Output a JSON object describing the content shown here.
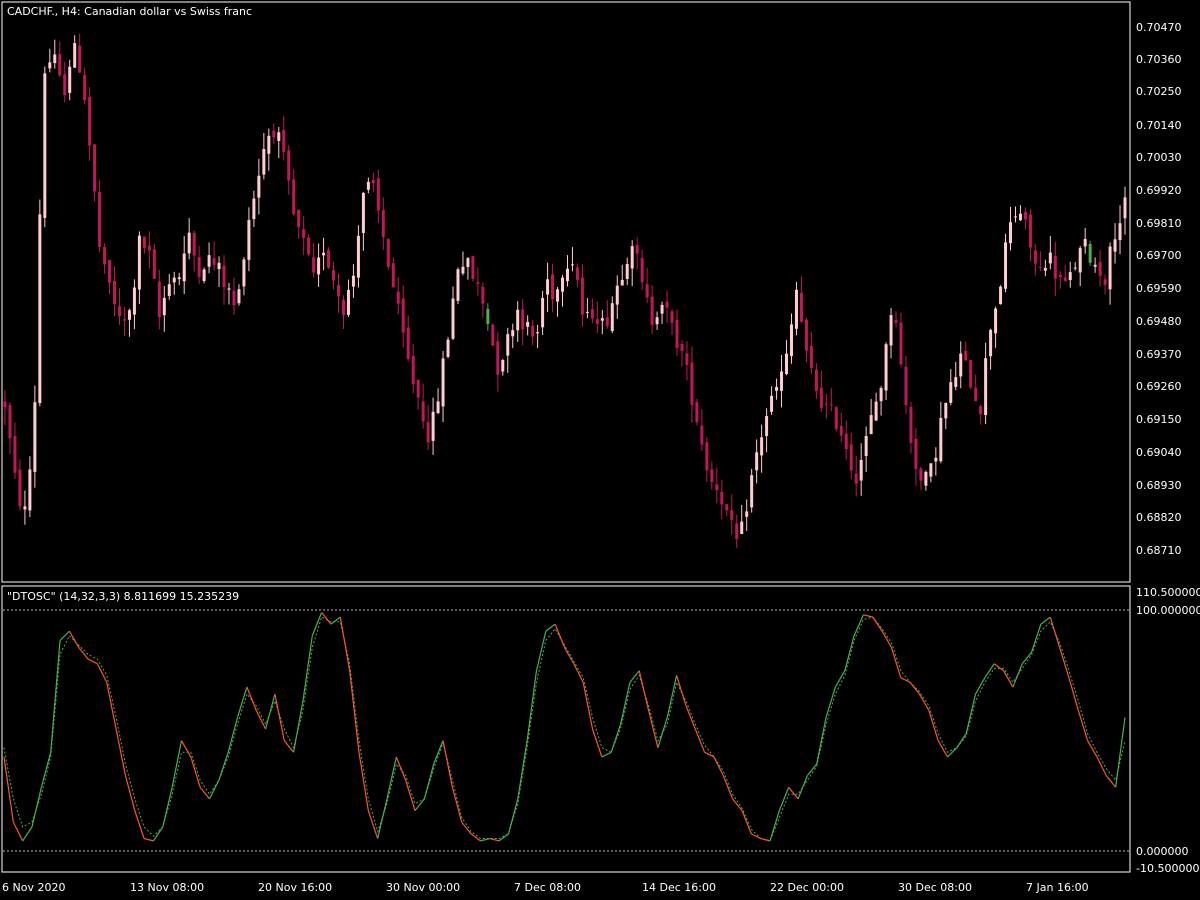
{
  "main_title": "CADCHF., H4:  Canadian dollar vs Swiss franc",
  "indicator_title": "\"DTOSC\" (14,32,3,3) 8.811699 15.235239",
  "colors": {
    "background": "#000000",
    "frame": "#ffffff",
    "candle_bear": "#c2185b",
    "candle_bull": "#ffcdd2",
    "candle_alt": "#4caf50",
    "osc_up": "#4caf50",
    "osc_down": "#ff5722",
    "grid_level": "#bdbdbd"
  },
  "chart_data": [
    {
      "type": "candlestick",
      "title": "CADCHF., H4:  Canadian dollar vs Swiss franc",
      "ylim": [
        0.6862,
        0.7052
      ],
      "y_ticks": [
        "0.70470",
        "0.70360",
        "0.70250",
        "0.70140",
        "0.70030",
        "0.69920",
        "0.69810",
        "0.69700",
        "0.69590",
        "0.69480",
        "0.69370",
        "0.69260",
        "0.69150",
        "0.69040",
        "0.68930",
        "0.68820",
        "0.68710"
      ],
      "x_ticks": [
        "6 Nov 2020",
        "13 Nov 08:00",
        "20 Nov 16:00",
        "30 Nov 00:00",
        "7 Dec 08:00",
        "14 Dec 16:00",
        "22 Dec 00:00",
        "30 Dec 08:00",
        "7 Jan 16:00"
      ],
      "close_path": [
        0.692,
        0.6895,
        0.6882,
        0.691,
        0.703,
        0.7035,
        0.7022,
        0.7038,
        0.703,
        0.6998,
        0.6965,
        0.6958,
        0.6945,
        0.695,
        0.6975,
        0.6968,
        0.6948,
        0.6962,
        0.6962,
        0.6975,
        0.6965,
        0.6968,
        0.6965,
        0.6958,
        0.695,
        0.6978,
        0.6992,
        0.7008,
        0.7012,
        0.6998,
        0.698,
        0.6972,
        0.696,
        0.6972,
        0.6962,
        0.6952,
        0.696,
        0.699,
        0.6992,
        0.6978,
        0.6962,
        0.6945,
        0.693,
        0.692,
        0.6908,
        0.6925,
        0.6945,
        0.6968,
        0.6965,
        0.6958,
        0.6948,
        0.6932,
        0.694,
        0.6952,
        0.6945,
        0.694,
        0.6962,
        0.6955,
        0.6968,
        0.6968,
        0.6945,
        0.6952,
        0.6945,
        0.6955,
        0.6965,
        0.6975,
        0.6958,
        0.6948,
        0.6955,
        0.6945,
        0.6938,
        0.6925,
        0.691,
        0.6895,
        0.6892,
        0.688,
        0.6872,
        0.689,
        0.6905,
        0.6918,
        0.6925,
        0.6935,
        0.6958,
        0.6935,
        0.6925,
        0.6918,
        0.6915,
        0.6908,
        0.6895,
        0.6905,
        0.6918,
        0.693,
        0.6958,
        0.6925,
        0.6905,
        0.6892,
        0.6898,
        0.6915,
        0.6925,
        0.6935,
        0.6928,
        0.6918,
        0.6945,
        0.6958,
        0.6978,
        0.6985,
        0.6975,
        0.6962,
        0.697,
        0.6962,
        0.6958,
        0.6968,
        0.6972,
        0.6965,
        0.6962,
        0.6978,
        0.6985
      ]
    },
    {
      "type": "line",
      "title": "\"DTOSC\" (14,32,3,3) 8.811699 15.235239",
      "ylim": [
        -10.5,
        110.5
      ],
      "y_ticks": [
        "110.500000",
        "100.000000",
        "0.000000",
        "-10.500000"
      ],
      "levels": [
        100,
        0
      ],
      "series": [
        {
          "values": [
            38,
            10,
            2,
            8,
            25,
            40,
            88,
            92,
            85,
            80,
            78,
            70,
            50,
            30,
            15,
            3,
            2,
            8,
            25,
            45,
            38,
            25,
            20,
            28,
            40,
            55,
            68,
            58,
            50,
            65,
            45,
            40,
            62,
            90,
            100,
            95,
            98,
            75,
            40,
            15,
            3,
            20,
            38,
            28,
            15,
            20,
            35,
            45,
            25,
            10,
            5,
            2,
            3,
            2,
            5,
            20,
            45,
            75,
            92,
            95,
            85,
            78,
            70,
            50,
            38,
            40,
            52,
            70,
            75,
            58,
            42,
            55,
            73,
            60,
            50,
            40,
            38,
            30,
            20,
            15,
            5,
            3,
            2,
            15,
            25,
            20,
            30,
            35,
            55,
            68,
            75,
            90,
            99,
            98,
            92,
            85,
            72,
            70,
            65,
            58,
            45,
            38,
            42,
            48,
            65,
            72,
            78,
            75,
            68,
            78,
            83,
            95,
            98,
            85,
            72,
            58,
            45,
            38,
            30,
            25,
            55
          ]
        },
        {
          "values": [
            42,
            20,
            8,
            10,
            22,
            38,
            82,
            90,
            86,
            82,
            80,
            73,
            55,
            35,
            20,
            8,
            4,
            8,
            22,
            40,
            40,
            28,
            22,
            28,
            38,
            52,
            65,
            60,
            52,
            62,
            50,
            42,
            58,
            85,
            98,
            96,
            96,
            78,
            45,
            20,
            6,
            18,
            35,
            30,
            18,
            20,
            33,
            44,
            28,
            12,
            6,
            3,
            3,
            3,
            5,
            18,
            42,
            70,
            88,
            93,
            86,
            79,
            72,
            55,
            42,
            40,
            50,
            67,
            73,
            60,
            45,
            52,
            70,
            62,
            52,
            43,
            38,
            32,
            22,
            16,
            7,
            3,
            2,
            12,
            22,
            22,
            28,
            34,
            52,
            65,
            73,
            88,
            97,
            98,
            93,
            87,
            75,
            70,
            66,
            60,
            48,
            40,
            42,
            47,
            62,
            70,
            76,
            76,
            70,
            76,
            82,
            92,
            96,
            87,
            75,
            62,
            48,
            40,
            33,
            28,
            45
          ]
        }
      ]
    }
  ]
}
